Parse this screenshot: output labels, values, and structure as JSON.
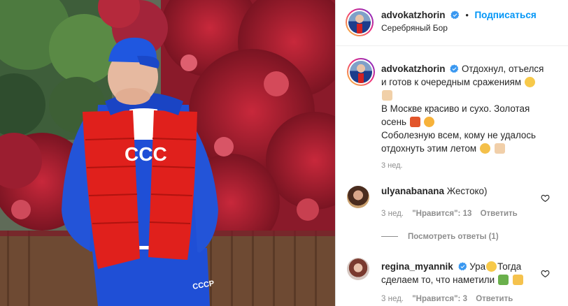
{
  "header": {
    "username": "advokatzhorin",
    "separator": "•",
    "follow_label": "Подписаться",
    "location": "Серебряный Бор"
  },
  "caption": {
    "username": "advokatzhorin",
    "lines": [
      "Отдохнул, отъелся",
      "и готов к очередным сражениям",
      "В Москве красиво и сухо. Золотая",
      "осень",
      "Соболезную всем, кому не удалось",
      "отдохнуть этим летом"
    ],
    "time": "3 нед."
  },
  "comments": [
    {
      "username": "ulyanabanana",
      "text": "Жестоко)",
      "time": "3 нед.",
      "likes": "\"Нравится\": 13",
      "reply": "Ответить",
      "view_replies": "Посмотреть ответы (1)"
    },
    {
      "username": "regina_myannik",
      "text_1": "Ура",
      "text_2": "Тогда",
      "text_3": "сделаем то, что наметили",
      "time": "3 нед.",
      "likes": "\"Нравится\": 3",
      "reply": "Ответить"
    }
  ],
  "photo": {
    "jacket_letters": "ССС",
    "pants_letters": "СССР"
  },
  "icons": {
    "verified": "verified-badge-icon",
    "more": "more-options-icon",
    "heart": "heart-outline-icon"
  },
  "colors": {
    "link_blue": "#0095f6",
    "verified_blue": "#3897f0",
    "meta_gray": "#8e8e8e",
    "vest_red": "#e0201c",
    "tracksuit_blue": "#1f4fd6"
  }
}
